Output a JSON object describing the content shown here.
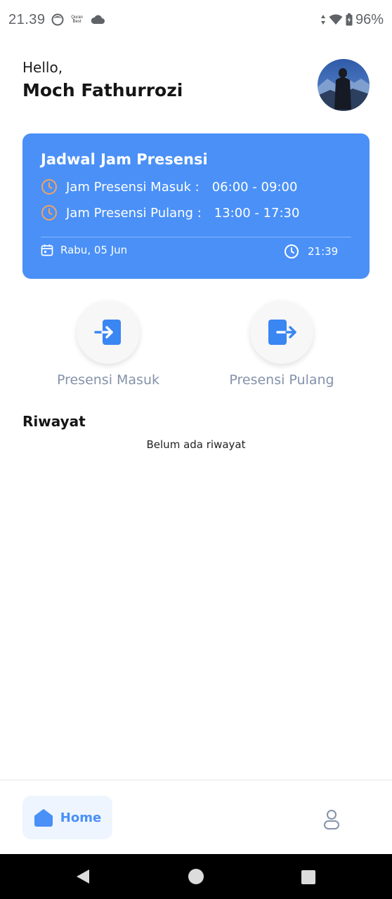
{
  "status_bar": {
    "time": "21.39",
    "quran_label_line1": "Quran",
    "quran_label_line2": "Best",
    "battery": "96%"
  },
  "header": {
    "greeting": "Hello,",
    "user_name": "Moch Fathurrozi"
  },
  "schedule": {
    "title": "Jadwal Jam Presensi",
    "rows": [
      {
        "label": "Jam Presensi Masuk :",
        "value": "06:00 - 09:00"
      },
      {
        "label": "Jam Presensi Pulang :",
        "value": "13:00 - 17:30"
      }
    ],
    "date": "Rabu, 05 Jun",
    "time": "21:39",
    "accent_color": "#4a90f7",
    "clock_icon_color": "#f5a25d"
  },
  "actions": {
    "masuk_label": "Presensi Masuk",
    "pulang_label": "Presensi Pulang"
  },
  "history": {
    "title": "Riwayat",
    "empty_text": "Belum ada riwayat"
  },
  "bottom_nav": {
    "home_label": "Home",
    "active_tab": "home"
  }
}
